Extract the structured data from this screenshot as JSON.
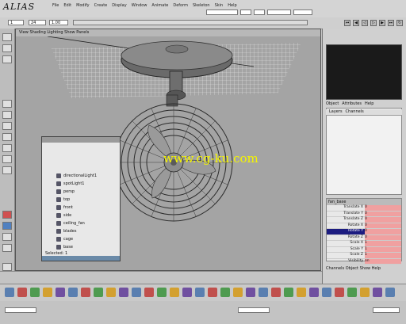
{
  "app": {
    "logo_text": "ALIAS"
  },
  "menus": [
    "File",
    "Edit",
    "Modify",
    "Create",
    "Display",
    "Window",
    "Animate",
    "Deform",
    "Skeleton",
    "Skin",
    "Help"
  ],
  "timeline": {
    "field_a": "1",
    "field_b": "24",
    "field_c": "1.00"
  },
  "viewport": {
    "menu": "View  Shading  Lighting  Show  Panels",
    "watermark": "www.cg-ku.com"
  },
  "outliner": {
    "items": [
      "directionalLight1",
      "spotLight1",
      "persp",
      "top",
      "front",
      "side",
      "ceiling_fan",
      "blades",
      "cage",
      "base"
    ],
    "status": "Selected: 1"
  },
  "right_panel": {
    "tabs": [
      "Object",
      "Attributes",
      "Help"
    ],
    "subtabs": [
      "Layers",
      "Channels"
    ],
    "table_header": "fan_base",
    "rows": [
      {
        "k": "Translate X",
        "v": "0"
      },
      {
        "k": "Translate Y",
        "v": "0"
      },
      {
        "k": "Translate Z",
        "v": "0"
      },
      {
        "k": "Rotate X",
        "v": "0"
      },
      {
        "k": "Rotate Y",
        "v": "0"
      },
      {
        "k": "Rotate Z",
        "v": "0"
      },
      {
        "k": "Scale X",
        "v": "1"
      },
      {
        "k": "Scale Y",
        "v": "1"
      },
      {
        "k": "Scale Z",
        "v": "1"
      },
      {
        "k": "Visibility",
        "v": "on"
      }
    ],
    "status": "Channels  Object  Show  Help"
  },
  "colors": {
    "accent": "#1c1c80",
    "watermark": "#f5f500",
    "channel": "#f0a0a0"
  }
}
